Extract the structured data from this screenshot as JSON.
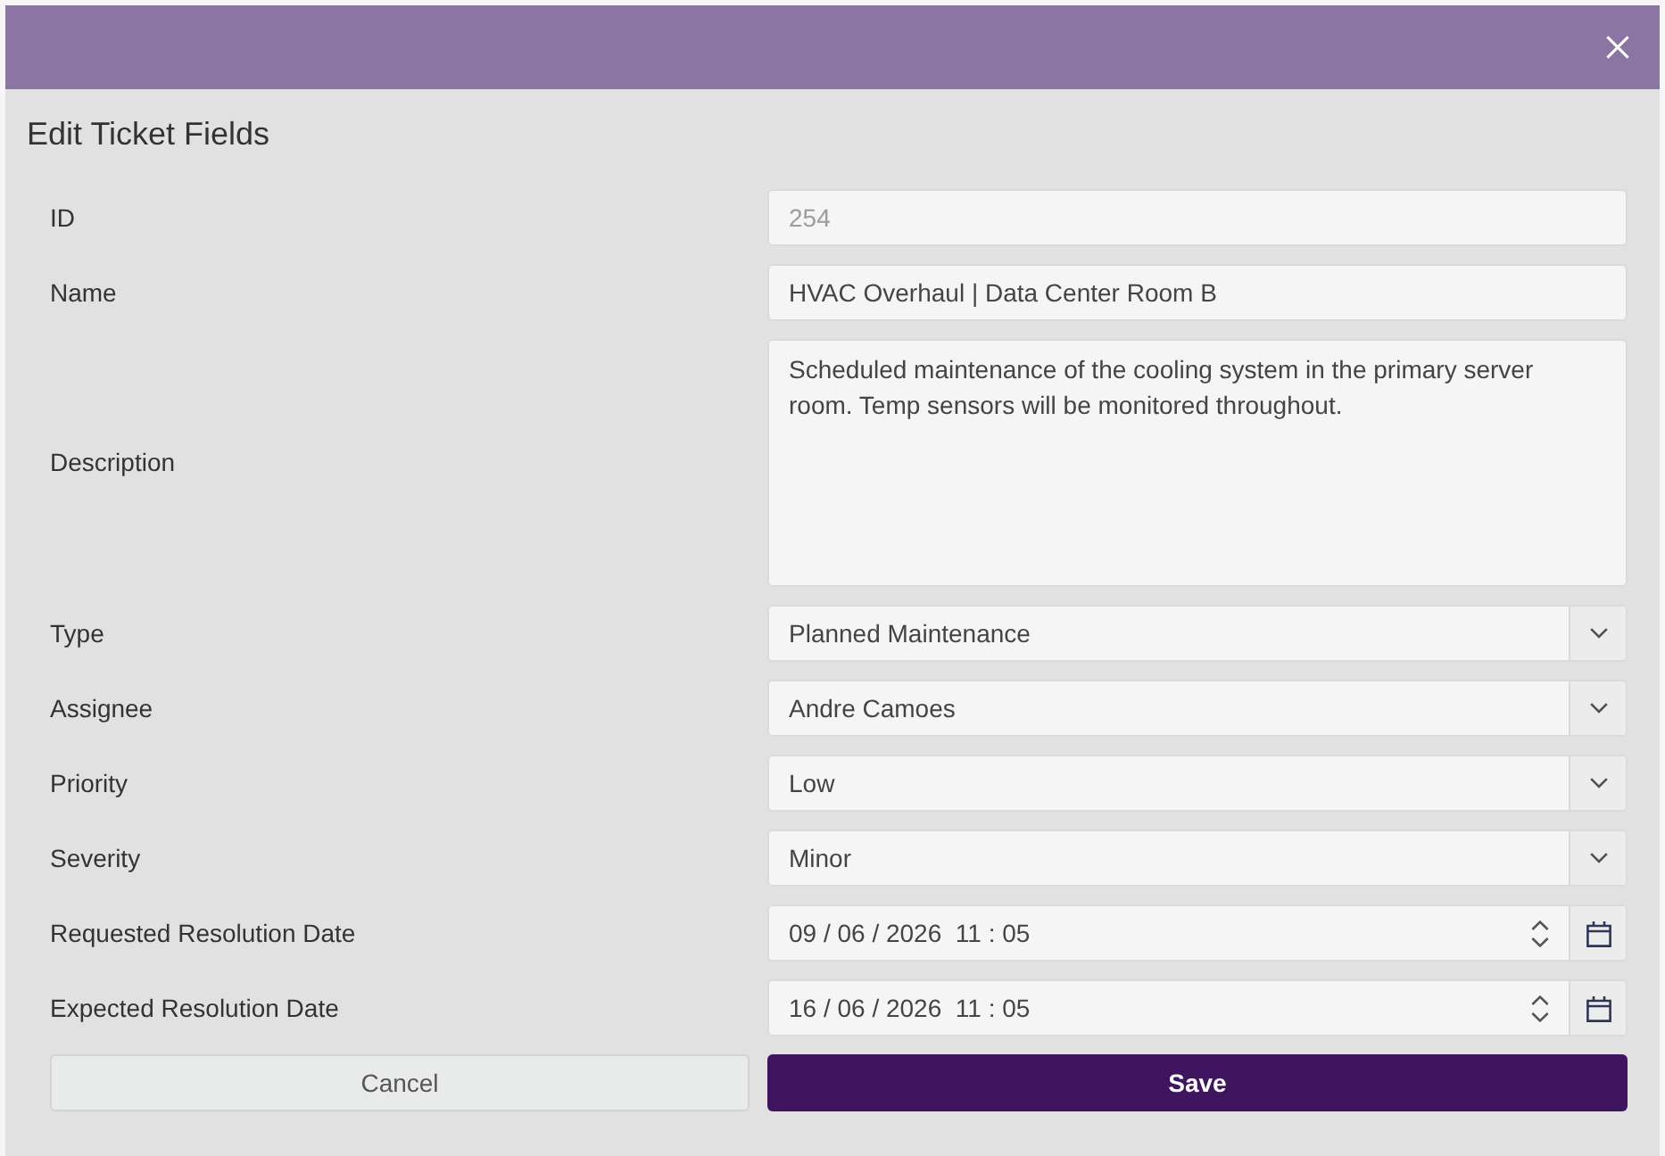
{
  "dialog": {
    "title": "Edit Ticket Fields"
  },
  "fields": [
    {
      "label": "ID",
      "kind": "text",
      "value": "254",
      "disabled": true
    },
    {
      "label": "Name",
      "kind": "text",
      "value": "HVAC Overhaul | Data Center Room B",
      "disabled": false
    },
    {
      "label": "Description",
      "kind": "textarea",
      "value": "Scheduled maintenance of the cooling system in the primary server room. Temp sensors will be monitored throughout.",
      "disabled": false
    },
    {
      "label": "Type",
      "kind": "select",
      "value": "Planned Maintenance",
      "disabled": false
    },
    {
      "label": "Assignee",
      "kind": "select",
      "value": "Andre Camoes",
      "disabled": false
    },
    {
      "label": "Priority",
      "kind": "select",
      "value": "Low",
      "disabled": false
    },
    {
      "label": "Severity",
      "kind": "select",
      "value": "Minor",
      "disabled": false
    },
    {
      "label": "Requested Resolution Date",
      "kind": "datetime",
      "value": "09 / 06 / 2026  11 : 05",
      "disabled": false
    },
    {
      "label": "Expected Resolution Date",
      "kind": "datetime",
      "value": "16 / 06 / 2026  11 : 05",
      "disabled": false
    }
  ],
  "buttons": [
    {
      "label": "Cancel",
      "kind": "secondary"
    },
    {
      "label": "Save",
      "kind": "primary"
    }
  ]
}
